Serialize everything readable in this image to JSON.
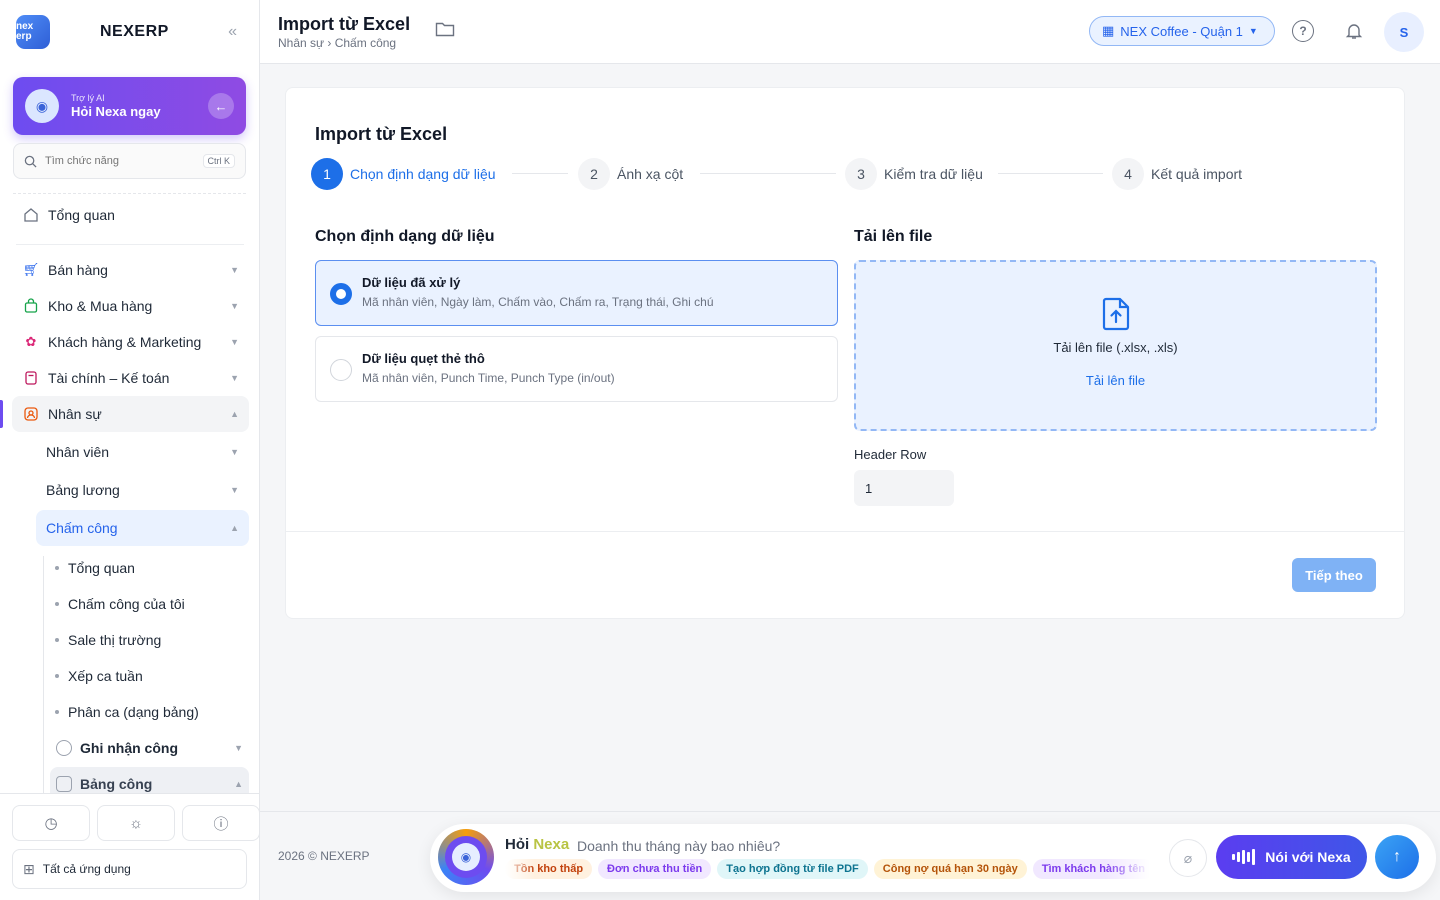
{
  "sidebar": {
    "brand_logo_text": "nex erp",
    "brand_name": "NEXERP",
    "collapse_icon": "chevrons-left-icon",
    "ai": {
      "small": "Trợ lý AI",
      "big": "Hỏi Nexa ngay"
    },
    "search": {
      "placeholder": "Tìm chức năng",
      "shortcut": "Ctrl K"
    },
    "overview": "Tổng quan",
    "modules": [
      {
        "label": "Bán hàng",
        "icon": "cart-icon"
      },
      {
        "label": "Kho & Mua hàng",
        "icon": "bag-icon"
      },
      {
        "label": "Khách hàng & Marketing",
        "icon": "people-icon"
      },
      {
        "label": "Tài chính – Kế toán",
        "icon": "calculator-icon"
      },
      {
        "label": "Nhân sự",
        "icon": "user-badge-icon"
      }
    ],
    "hr_sub": [
      "Nhân viên",
      "Bảng lương",
      "Chấm công"
    ],
    "attendance_leaves": [
      "Tổng quan",
      "Chấm công của tôi",
      "Sale thị trường",
      "Xếp ca tuần",
      "Phân ca (dạng bảng)"
    ],
    "attendance_groups": [
      "Ghi nhận công",
      "Bảng công"
    ],
    "all_apps": "Tất cả ứng dụng"
  },
  "header": {
    "title": "Import từ Excel",
    "breadcrumb": "Nhân sự › Chấm công",
    "store": "NEX Coffee - Quận 1",
    "avatar": "S"
  },
  "card": {
    "title": "Import từ Excel",
    "steps": [
      {
        "num": "1",
        "label": "Chọn định dạng dữ liệu"
      },
      {
        "num": "2",
        "label": "Ánh xạ cột"
      },
      {
        "num": "3",
        "label": "Kiểm tra dữ liệu"
      },
      {
        "num": "4",
        "label": "Kết quả import"
      }
    ],
    "format_title": "Chọn định dạng dữ liệu",
    "options": [
      {
        "title": "Dữ liệu đã xử lý",
        "desc": "Mã nhân viên, Ngày làm, Chấm vào, Chấm ra, Trạng thái, Ghi chú"
      },
      {
        "title": "Dữ liệu quẹt thẻ thô",
        "desc": "Mã nhân viên, Punch Time, Punch Type (in/out)"
      }
    ],
    "upload_title": "Tải lên file",
    "upload_text": "Tải lên file (.xlsx, .xls)",
    "upload_link": "Tải lên file",
    "header_row_label": "Header Row",
    "header_row_value": "1",
    "next": "Tiếp theo"
  },
  "footer": {
    "copyright": "2026 © NEXERP",
    "ask_prefix": "Hỏi ",
    "ask_brand": "Nexa",
    "question": "Doanh thu tháng này bao nhiêu?",
    "chips": [
      "Tồn kho thấp",
      "Đơn chưa thu tiền",
      "Tạo hợp đồng từ file PDF",
      "Công nợ quá hạn 30 ngày",
      "Tìm khách hàng tên"
    ],
    "voice": "Nói với Nexa"
  },
  "colors": {
    "accent": "#1d6fe8",
    "ai_purple": "#6d4cf0"
  }
}
